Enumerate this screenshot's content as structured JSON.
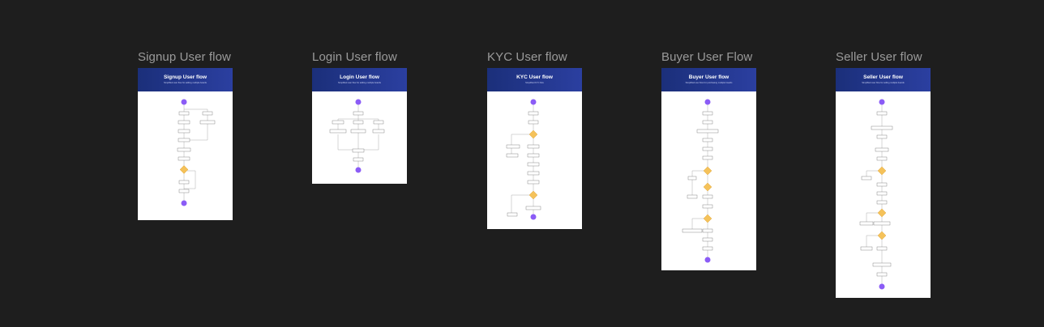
{
  "boards": [
    {
      "label": "Signup User flow",
      "header": {
        "title": "Signup User flow",
        "subtitle": "Simplified user flow for adding multiple boards"
      }
    },
    {
      "label": "Login User flow",
      "header": {
        "title": "Login User flow",
        "subtitle": "Simplified user flow for adding multiple boards"
      }
    },
    {
      "label": "KYC User flow",
      "header": {
        "title": "KYC User flow",
        "subtitle": "Simplified KYC flow"
      }
    },
    {
      "label": "Buyer User Flow",
      "header": {
        "title": "Buyer User flow",
        "subtitle": "Simplified user flow for purchasing multiple boards"
      }
    },
    {
      "label": "Seller User flow",
      "header": {
        "title": "Seller User flow",
        "subtitle": "Simplified user flow for selling multiple boards"
      }
    }
  ],
  "colors": {
    "canvas": "#1e1e1e",
    "header": "#1b2f7a",
    "terminal": "#8b5cf6",
    "decision": "#f5c25a"
  }
}
